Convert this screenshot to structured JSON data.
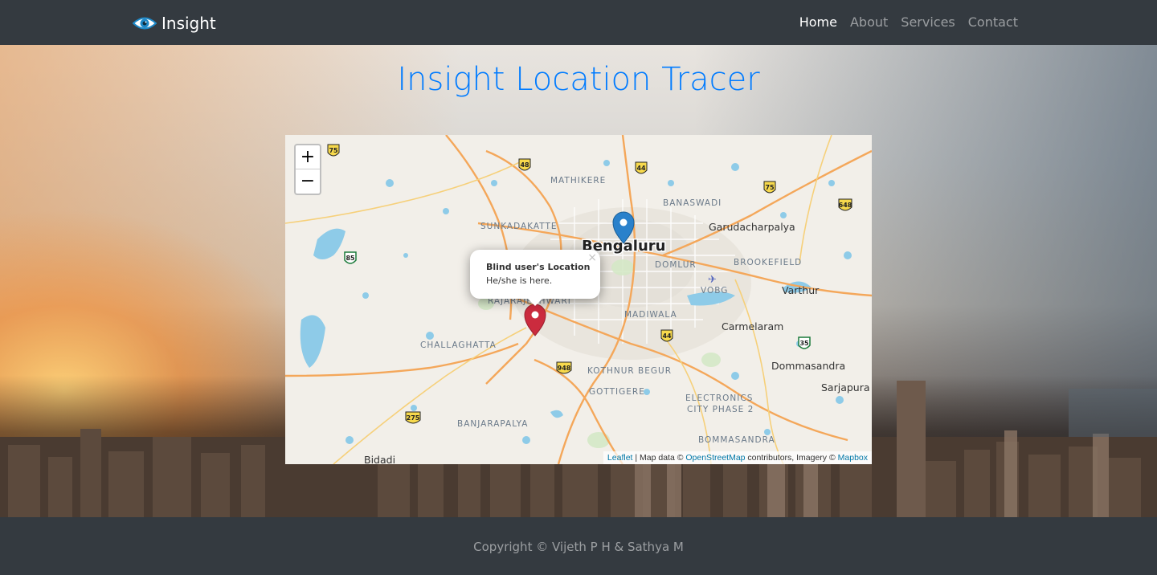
{
  "navbar": {
    "brand": "Insight",
    "links": [
      {
        "label": "Home",
        "active": true
      },
      {
        "label": "About",
        "active": false
      },
      {
        "label": "Services",
        "active": false
      },
      {
        "label": "Contact",
        "active": false
      }
    ]
  },
  "page": {
    "title": "Insight Location Tracer"
  },
  "map": {
    "zoom_in": "+",
    "zoom_out": "−",
    "popup": {
      "title": "Blind user's Location",
      "body": "He/she is here.",
      "close": "×"
    },
    "places": {
      "city": "Bengaluru",
      "mathikere": "MATHIKERE",
      "banaswadi": "BANASWADI",
      "sunkadakatte": "SUNKADAKATTE",
      "garudacharpalya": "Garudacharpalya",
      "domlur": "DOMLUR",
      "brookefield": "BROOKEFIELD",
      "vobg": "VOBG",
      "varthur": "Varthur",
      "rajarajeshwari": "RAJARAJESHWARI",
      "madiwala": "MADIWALA",
      "carmelaram": "Carmelaram",
      "challaghatta": "CHALLAGHATTA",
      "dommasandra": "Dommasandra",
      "kothnur": "KOTHNUR BEGUR",
      "gottigere": "GOTTIGERE",
      "sarjapura": "Sarjapura",
      "electronics1": "ELECTRONICS",
      "electronics2": "CITY PHASE 2",
      "banjarapalya": "BANJARAPALYA",
      "bommasandra": "BOMMASANDRA",
      "bidadi": "Bidadi"
    },
    "shields": [
      "75",
      "48",
      "44",
      "75",
      "648",
      "85",
      "44",
      "35",
      "948",
      "275"
    ],
    "attribution": {
      "leaflet": "Leaflet",
      "sep": " | Map data © ",
      "osm": "OpenStreetMap",
      "mid": " contributors, Imagery © ",
      "mapbox": "Mapbox"
    },
    "markers": {
      "user_color": "#cb2b3e",
      "center_color": "#2a81cb"
    }
  },
  "footer": {
    "copyright": "Copyright © Vijeth P H & Sathya M"
  },
  "colors": {
    "navbar": "#343a40",
    "title": "#007bff"
  }
}
